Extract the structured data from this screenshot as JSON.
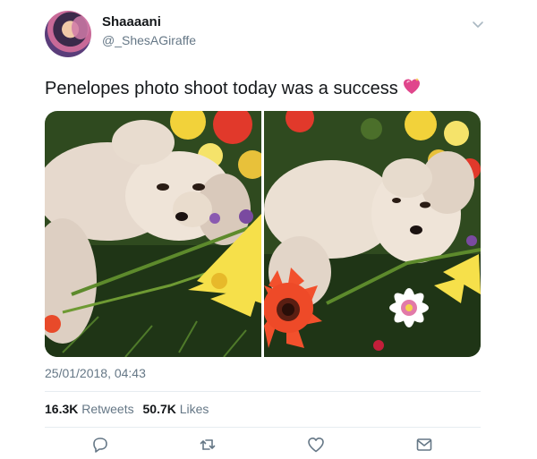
{
  "tweet": {
    "display_name": "Shaaaani",
    "handle": "@_ShesAGiraffe",
    "text": "Penelopes photo shoot today was a success",
    "emoji": "sparkling-heart",
    "timestamp": "25/01/2018, 04:43",
    "stats": {
      "retweets_count": "16.3K",
      "retweets_label": "Retweets",
      "likes_count": "50.7K",
      "likes_label": "Likes"
    },
    "media": [
      {
        "subject": "small fluffy dog lying on grass with yellow and red flowers"
      },
      {
        "subject": "small fluffy dog lying on grass with red gerbera and white flower"
      }
    ],
    "actions": [
      "reply-icon",
      "retweet-icon",
      "like-icon",
      "direct-message-icon"
    ]
  },
  "colors": {
    "text_primary": "#14171a",
    "text_secondary": "#657786",
    "divider": "#e6ecf0",
    "emoji_heart": "#e0468c"
  }
}
